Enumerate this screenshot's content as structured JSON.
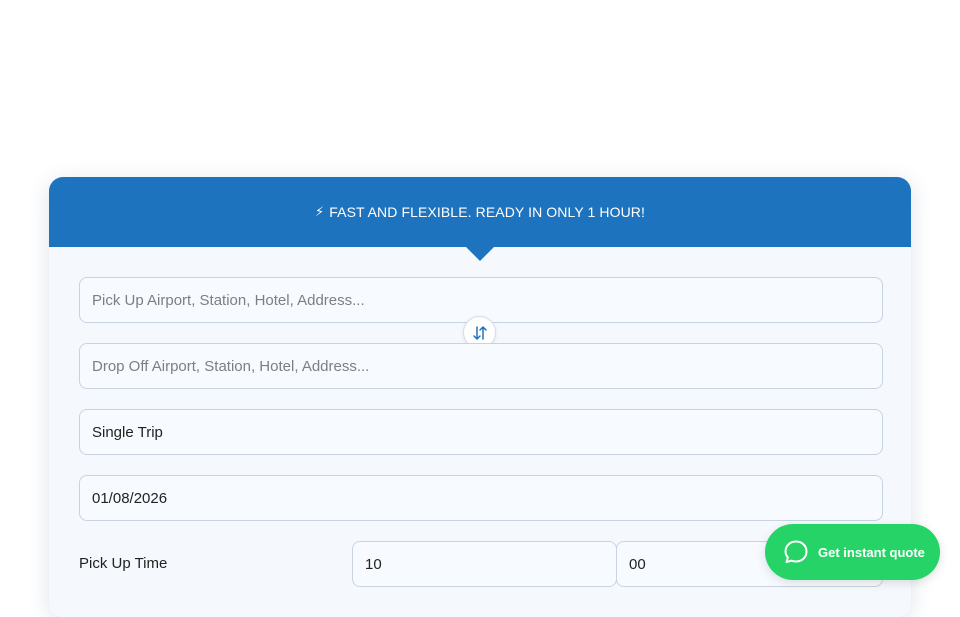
{
  "banner": {
    "icon": "lightning-bolt-icon",
    "text": "FAST AND FLEXIBLE. READY IN ONLY 1 HOUR!"
  },
  "pickup": {
    "placeholder": "Pick Up Airport, Station, Hotel, Address...",
    "value": ""
  },
  "swap": {
    "icon": "swap-arrows-icon"
  },
  "dropoff": {
    "placeholder": "Drop Off Airport, Station, Hotel, Address...",
    "value": ""
  },
  "trip_type": {
    "value": "Single Trip"
  },
  "date": {
    "value": "01/08/2026"
  },
  "pickup_time": {
    "label": "Pick Up Time",
    "hour": "10",
    "minute": "00"
  },
  "chat": {
    "icon": "chat-bubble-icon",
    "label": "Get instant quote"
  },
  "colors": {
    "primary": "#1e73be",
    "chat": "#25d366"
  }
}
